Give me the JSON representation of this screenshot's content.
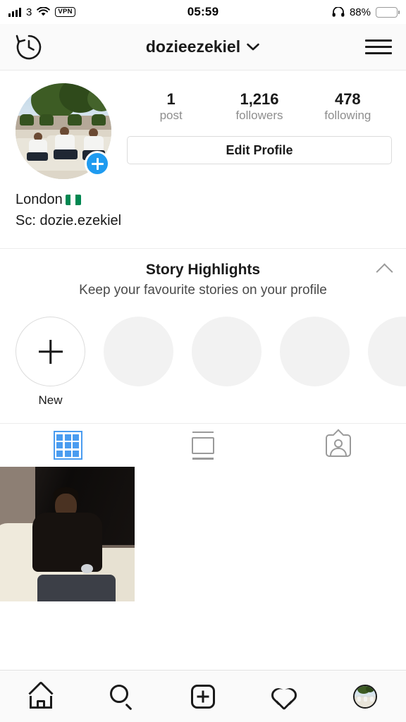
{
  "status_bar": {
    "carrier": "3",
    "signal_icon": "signal-bars-icon",
    "wifi_icon": "wifi-icon",
    "vpn_label": "VPN",
    "time": "05:59",
    "headphones_icon": "headphones-icon",
    "battery_percent": "88%",
    "battery_color": "#FFCC00"
  },
  "header": {
    "history_icon": "clock-history-icon",
    "username": "dozieezekiel",
    "chevron_icon": "chevron-down-icon",
    "menu_icon": "hamburger-menu-icon"
  },
  "profile": {
    "avatar_name": "profile-picture",
    "story_add_icon": "add-story-plus-icon",
    "story_add_color": "#1F9BF0",
    "stats": [
      {
        "num": "1",
        "label": "post"
      },
      {
        "num": "1,216",
        "label": "followers"
      },
      {
        "num": "478",
        "label": "following"
      }
    ],
    "edit_button": "Edit Profile",
    "bio_line_1": "London",
    "bio_flag": "nigeria-flag",
    "bio_line_2": "Sc: dozie.ezekiel"
  },
  "highlights": {
    "title": "Story Highlights",
    "subtitle": "Keep your favourite stories on your profile",
    "collapse_icon": "chevron-up-icon",
    "items": [
      {
        "label": "New",
        "type": "new"
      },
      {
        "label": "",
        "type": "placeholder"
      },
      {
        "label": "",
        "type": "placeholder"
      },
      {
        "label": "",
        "type": "placeholder"
      },
      {
        "label": "",
        "type": "placeholder"
      }
    ]
  },
  "tabs": {
    "active_color": "#4A9CF0",
    "inactive_color": "#9a9a9a",
    "items": [
      {
        "name": "grid-view-tab",
        "icon": "grid-icon",
        "active": true
      },
      {
        "name": "feed-view-tab",
        "icon": "feed-list-icon",
        "active": false
      },
      {
        "name": "tagged-tab",
        "icon": "tagged-person-icon",
        "active": false
      }
    ]
  },
  "posts": [
    {
      "name": "post-thumbnail",
      "alt": "Person in black puffer jacket seated on cream sofa"
    }
  ],
  "bottom_nav": [
    {
      "name": "home-tab",
      "icon": "home-icon"
    },
    {
      "name": "search-tab",
      "icon": "search-icon"
    },
    {
      "name": "create-post-tab",
      "icon": "plus-square-icon"
    },
    {
      "name": "activity-tab",
      "icon": "heart-icon"
    },
    {
      "name": "profile-tab",
      "icon": "profile-avatar-icon"
    }
  ]
}
